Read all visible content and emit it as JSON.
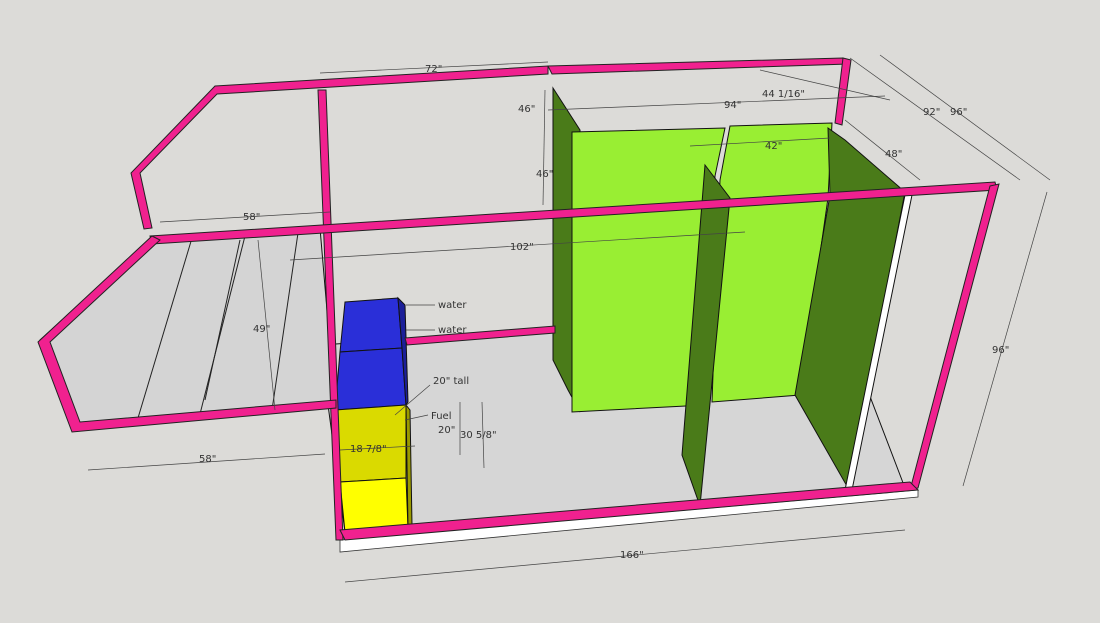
{
  "dimensions": {
    "d72": "72\"",
    "d46a": "46\"",
    "d46b": "46\"",
    "d94": "94\"",
    "d44": "44 1/16\"",
    "d92": "92\"",
    "d96top": "96\"",
    "d42": "42\"",
    "d48": "48\"",
    "d58top": "58\"",
    "d102": "102\"",
    "d49": "49\"",
    "d58bottom": "58\"",
    "d166": "166\"",
    "d96right": "96\"",
    "d20tall": "20\" tall",
    "d20": "20\"",
    "d30": "30 5/8\"",
    "d18": "18 7/8\""
  },
  "labels": {
    "water1": "water",
    "water2": "water",
    "fuel": "Fuel"
  },
  "colors": {
    "frame": "#f0218f",
    "bright_green": "#99ee33",
    "dark_green": "#4a7b19",
    "water_blue": "#2a2fd8",
    "fuel_yellow": "#dada00",
    "fuel_yellow_light": "#ffff00",
    "floor": "#d6d6d6"
  }
}
